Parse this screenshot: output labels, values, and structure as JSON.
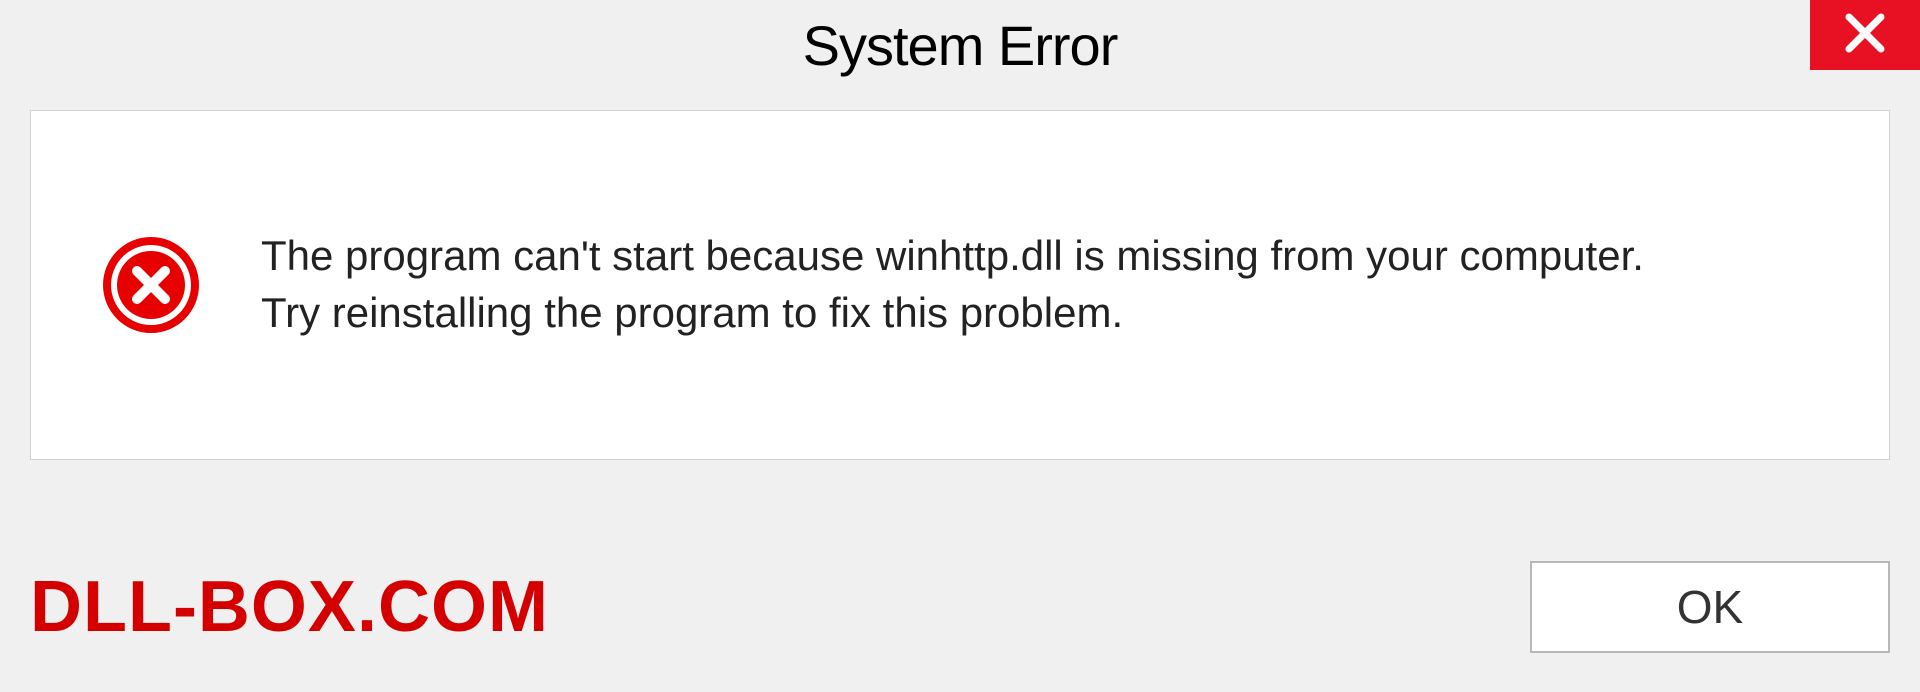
{
  "dialog": {
    "title": "System Error",
    "message_line1": "The program can't start because winhttp.dll is missing from your computer.",
    "message_line2": "Try reinstalling the program to fix this problem.",
    "ok_label": "OK"
  },
  "watermark": {
    "text": "DLL-BOX.COM"
  },
  "colors": {
    "close_bg": "#e81123",
    "error_icon": "#e60000",
    "watermark": "#d40000"
  }
}
